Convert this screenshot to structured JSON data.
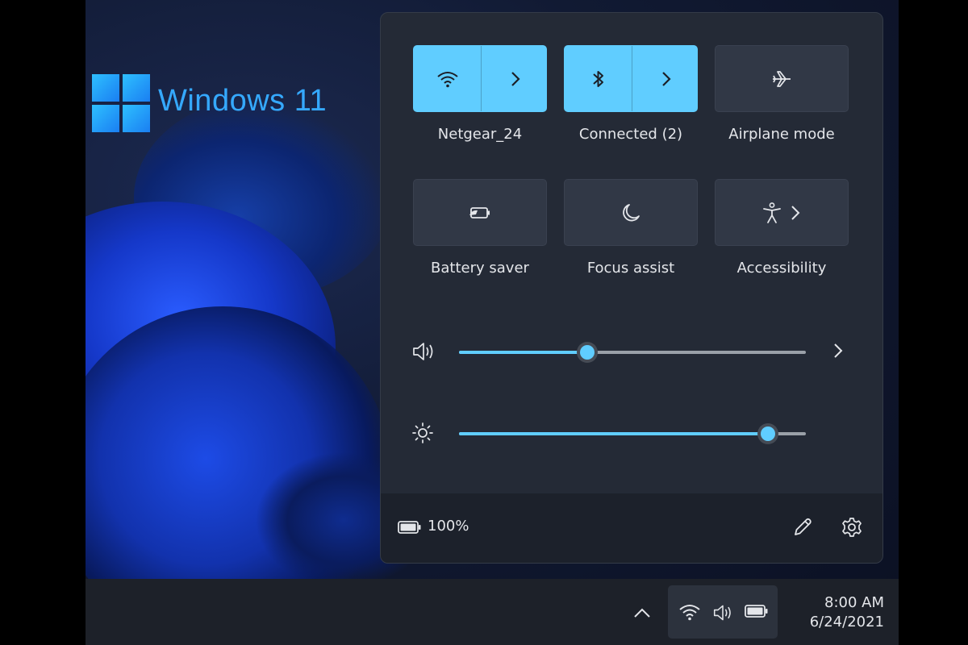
{
  "branding": {
    "title": "Windows 11"
  },
  "quick_settings": {
    "tiles": [
      {
        "label": "Netgear_24",
        "icon": "wifi-icon",
        "active": true,
        "expandable": true
      },
      {
        "label": "Connected (2)",
        "icon": "bluetooth-icon",
        "active": true,
        "expandable": true
      },
      {
        "label": "Airplane mode",
        "icon": "airplane-icon",
        "active": false,
        "expandable": false
      },
      {
        "label": "Battery saver",
        "icon": "battery-saver-icon",
        "active": false,
        "expandable": false
      },
      {
        "label": "Focus assist",
        "icon": "moon-icon",
        "active": false,
        "expandable": false
      },
      {
        "label": "Accessibility",
        "icon": "accessibility-icon",
        "active": false,
        "expandable": true
      }
    ],
    "volume": {
      "icon": "speaker-icon",
      "level": 0.37
    },
    "brightness": {
      "icon": "sun-icon",
      "level": 0.89
    },
    "footer": {
      "battery_percent": "100%",
      "icons": [
        "battery-icon",
        "pencil-icon",
        "gear-icon"
      ]
    }
  },
  "taskbar": {
    "tray_icons": [
      "chevron-up-icon",
      "wifi-icon",
      "speaker-icon",
      "battery-icon"
    ],
    "clock": {
      "time": "8:00 AM",
      "date": "6/24/2021"
    }
  },
  "colors": {
    "accent": "#60cdff",
    "panel": "#242a36",
    "taskbar": "#1d2129",
    "logo": "#35a9ff"
  }
}
